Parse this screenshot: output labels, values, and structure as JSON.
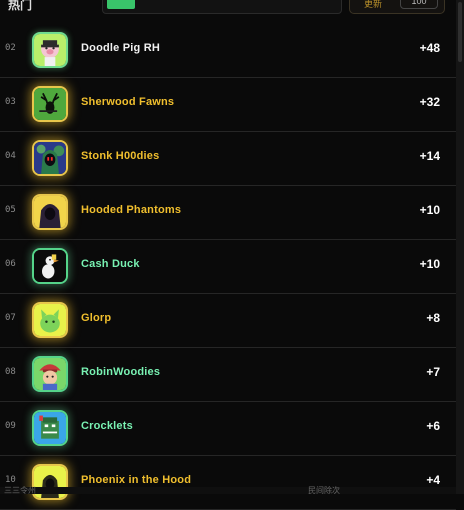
{
  "header": {
    "title": "热门",
    "control_label": "更新",
    "control_value": "100"
  },
  "rows": [
    {
      "rank": "02",
      "name": "Doodle Pig RH",
      "score": "+48",
      "accent": "#79f2b3",
      "name_style": "plain",
      "icon": "pig-avatar-icon"
    },
    {
      "rank": "03",
      "name": "Sherwood Fawns",
      "score": "+32",
      "accent": "#e8c64b",
      "name_style": "gold",
      "icon": "deer-avatar-icon"
    },
    {
      "rank": "04",
      "name": "Stonk H00dies",
      "score": "+14",
      "accent": "#e8c64b",
      "name_style": "gold",
      "icon": "hooded-figure-avatar-icon"
    },
    {
      "rank": "05",
      "name": "Hooded Phantoms",
      "score": "+10",
      "accent": "#e8c64b",
      "name_style": "gold",
      "icon": "phantom-avatar-icon"
    },
    {
      "rank": "06",
      "name": "Cash Duck",
      "score": "+10",
      "accent": "#55d48a",
      "name_style": "mint",
      "icon": "duck-avatar-icon"
    },
    {
      "rank": "07",
      "name": "Glorp",
      "score": "+8",
      "accent": "#e8c64b",
      "name_style": "gold",
      "icon": "alien-cat-avatar-icon"
    },
    {
      "rank": "08",
      "name": "RobinWoodies",
      "score": "+7",
      "accent": "#55d48a",
      "name_style": "mint",
      "icon": "robin-woodie-avatar-icon"
    },
    {
      "rank": "09",
      "name": "Crocklets",
      "score": "+6",
      "accent": "#55d48a",
      "name_style": "mint",
      "icon": "croc-avatar-icon"
    },
    {
      "rank": "10",
      "name": "Phoenix in the Hood",
      "score": "+4",
      "accent": "#e8c64b",
      "name_style": "gold",
      "icon": "phoenix-avatar-icon"
    }
  ],
  "footer": {
    "left_text": "三三令州",
    "right_text": "民间除次"
  }
}
